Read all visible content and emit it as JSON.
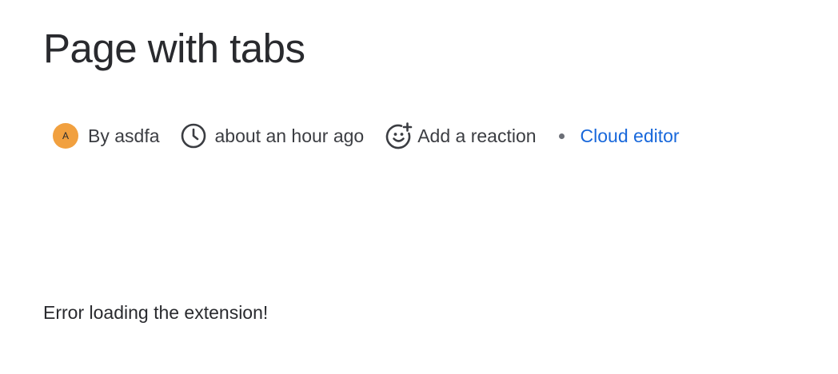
{
  "page": {
    "title": "Page with tabs"
  },
  "byline": {
    "avatar_initial": "A",
    "author": "By asdfa",
    "timestamp": "about an hour ago",
    "reaction_label": "Add a reaction",
    "editor_link": "Cloud editor",
    "icons": [
      "clock-icon",
      "add-reaction-icon"
    ],
    "colors": {
      "avatar": "#f1a03f",
      "link": "#1868db"
    }
  },
  "content": {
    "error_message": "Error loading the extension!"
  }
}
